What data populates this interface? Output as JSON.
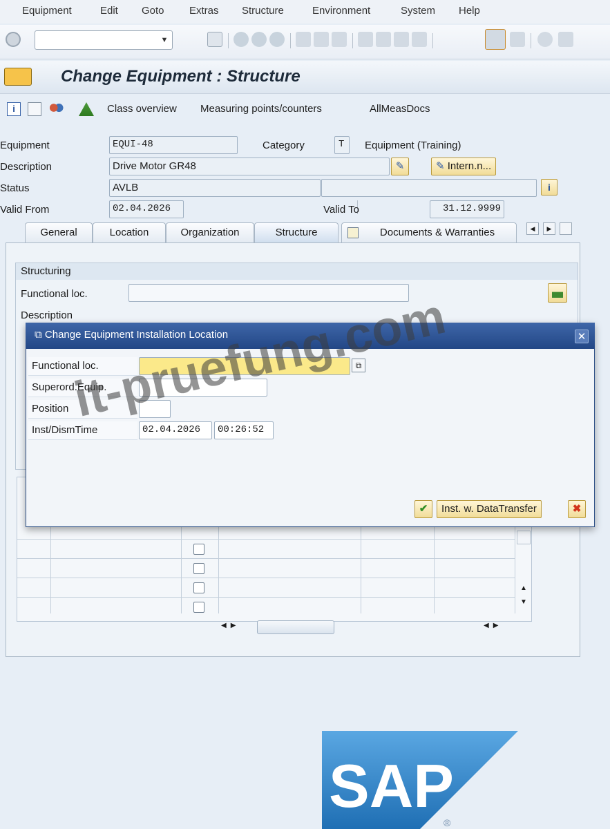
{
  "menu": [
    "Equipment",
    "Edit",
    "Goto",
    "Extras",
    "Structure",
    "Environment",
    "System",
    "Help"
  ],
  "title": "Change Equipment : Structure",
  "app_toolbar": {
    "class_overview": "Class overview",
    "measuring_points": "Measuring points/counters",
    "all_meas_docs": "AllMeasDocs"
  },
  "header": {
    "equipment_label": "Equipment",
    "equipment_value": "EQUI-48",
    "category_label": "Category",
    "category_value": "T",
    "category_desc": "Equipment (Training)",
    "description_label": "Description",
    "description_value": "Drive Motor GR48",
    "intern_button": "Intern.n...",
    "status_label": "Status",
    "status_value": "AVLB",
    "valid_from_label": "Valid From",
    "valid_from_value": "02.04.2026",
    "valid_to_label": "Valid To",
    "valid_to_value": "31.12.9999"
  },
  "tabs": [
    "General",
    "Location",
    "Organization",
    "Structure",
    "Documents & Warranties"
  ],
  "active_tab": "Structure",
  "structuring": {
    "title": "Structuring",
    "functional_loc_label": "Functional loc.",
    "description_label": "Description"
  },
  "dialog": {
    "title": "Change Equipment Installation Location",
    "functional_loc_label": "Functional loc.",
    "superord_label": "Superord.Equip.",
    "position_label": "Position",
    "inst_time_label": "Inst/DismTime",
    "inst_date": "02.04.2026",
    "inst_time": "00:26:52",
    "transfer_button": "Inst. w. DataTransfer"
  },
  "watermark": "it-pruefung.com",
  "logo": "SAP",
  "colors": {
    "dialog_header": "#2b4f8f",
    "required_field": "#fbe98a",
    "button_gold": "#f1dc98",
    "background": "#e7eef6"
  }
}
